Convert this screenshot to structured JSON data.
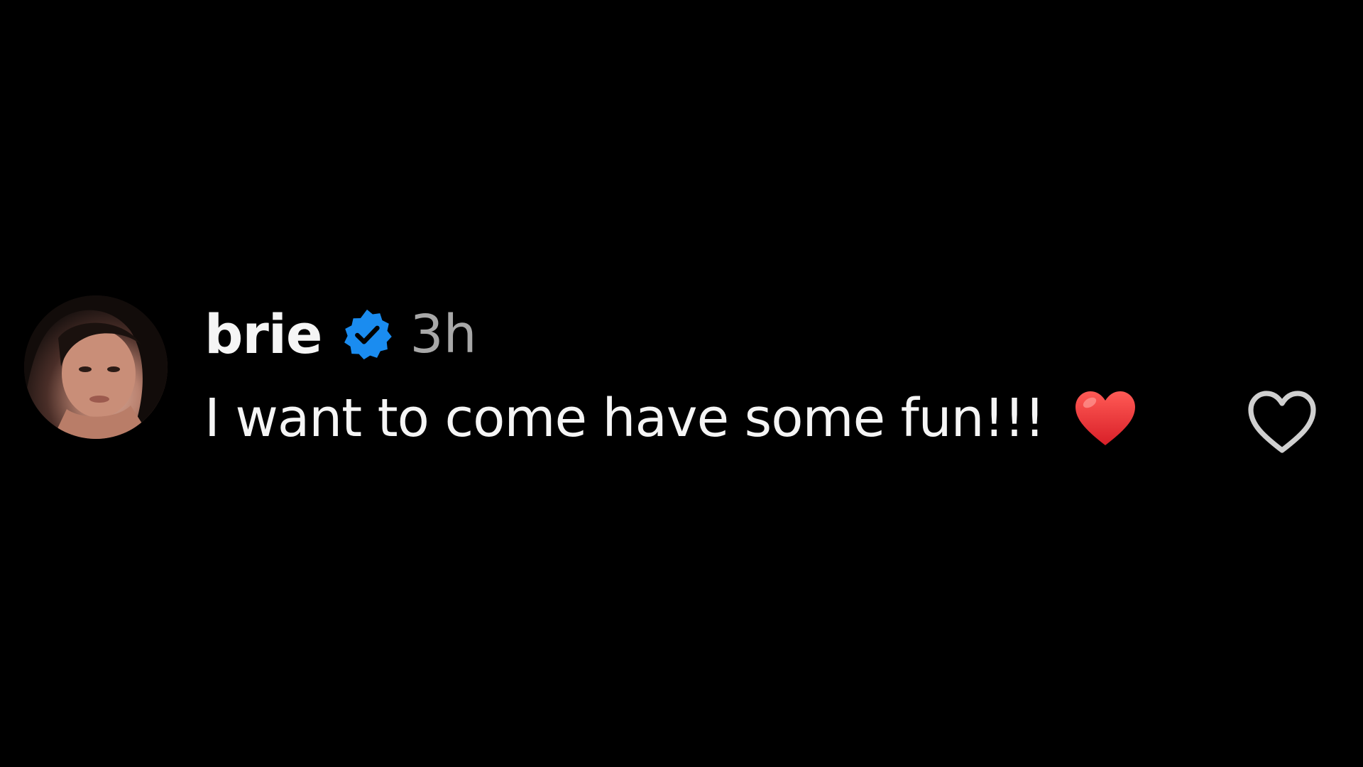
{
  "comment": {
    "username": "brie",
    "timestamp": "3h",
    "text": "I want to come have some fun!!!",
    "emoji": "red-heart",
    "verified": true,
    "like_icon": "heart-outline-icon"
  },
  "colors": {
    "background": "#000000",
    "username": "#f5f5f5",
    "timestamp": "#a8a8a8",
    "verified_badge": "#1a8cf0",
    "heart_emoji": "#e8242c",
    "like_outline": "#d0d0d0"
  }
}
